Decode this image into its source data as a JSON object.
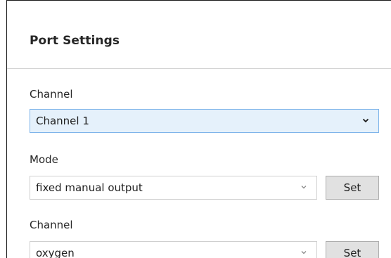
{
  "panel": {
    "title": "Port Settings"
  },
  "fields": {
    "channel1": {
      "label": "Channel",
      "value": "Channel 1"
    },
    "mode": {
      "label": "Mode",
      "value": "fixed manual output",
      "button_label": "Set"
    },
    "channel2": {
      "label": "Channel",
      "value": "oxygen",
      "button_label": "Set"
    }
  },
  "colors": {
    "active_select_bg": "#e5f1fb",
    "active_select_border": "#7eb4ea",
    "button_bg": "#e1e1e1"
  },
  "icons": {
    "dropdown": "chevron-down-icon"
  }
}
